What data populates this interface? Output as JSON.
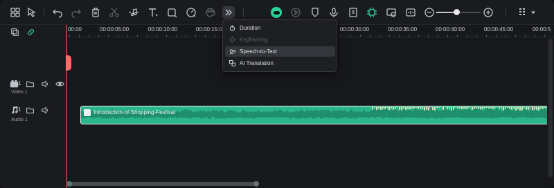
{
  "toolbar": {
    "icons": [
      "layout-icon",
      "select-tool-icon",
      "undo-icon",
      "redo-icon",
      "delete-icon",
      "cut-icon",
      "audio-split-icon",
      "text-icon",
      "crop-icon",
      "speed-icon",
      "color-icon",
      "more-tools-icon",
      "record-icon",
      "play-icon",
      "marker-icon",
      "mic-icon",
      "sticker-icon",
      "ai-icon",
      "snapshot-icon",
      "caption-icon",
      "zoom-out-icon",
      "zoom-in-icon",
      "grid-icon",
      "chevron-down-icon"
    ],
    "zoom_level": 0.45,
    "colors": {
      "accent": "#35d29e",
      "playhead": "#ff5a5a",
      "audio_clip": "#2ab58a"
    }
  },
  "menu": {
    "items": [
      {
        "label": "Duration",
        "icon": "stopwatch-icon",
        "state": "normal"
      },
      {
        "label": "Keyframing",
        "icon": "keyframe-icon",
        "state": "disabled"
      },
      {
        "label": "Speech-to-Text",
        "icon": "speech-to-text-icon",
        "state": "highlighted"
      },
      {
        "label": "AI Translation",
        "icon": "translate-icon",
        "state": "normal"
      }
    ]
  },
  "ruler": {
    "labels": [
      "00:00",
      "00:00:05:00",
      "00:00:10:00",
      "00:00:15:00",
      "00:00:30:00",
      "00:00:35:00",
      "00:00:40:00",
      "00:00:45:00",
      "00:00:5"
    ]
  },
  "tracks": {
    "video": {
      "number": "1",
      "label": "Video 1"
    },
    "audio": {
      "number": "1",
      "label": "Audio 1"
    }
  },
  "clip": {
    "title": "Introduction-of-Shopping-Festival"
  }
}
